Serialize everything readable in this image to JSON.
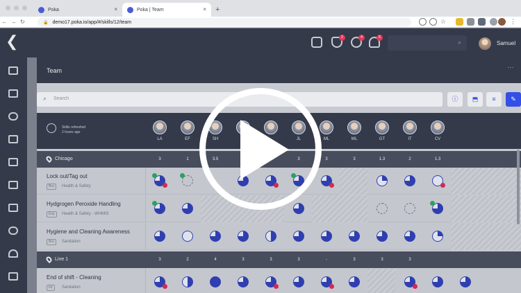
{
  "browser": {
    "tabs": [
      {
        "label": "Poka",
        "active": false
      },
      {
        "label": "Poka | Team",
        "active": true
      }
    ],
    "new_tab": "+",
    "close": "×",
    "url": "demo17.poka.io/app/#/skills/12/team"
  },
  "topbar": {
    "notifications": [
      {
        "icon": "shield-heart-icon",
        "count": "2"
      },
      {
        "icon": "refresh-alert-icon",
        "count": "4"
      },
      {
        "icon": "bell-icon",
        "count": "6"
      }
    ],
    "user_name": "Samuel"
  },
  "page": {
    "title": "Team",
    "more": "···",
    "search_placeholder": "Search",
    "refresh_text": [
      "Skills refreshed",
      "2 hours ago"
    ]
  },
  "members": [
    "LA",
    "EF",
    "SH",
    "",
    "JL",
    "ML",
    "WL",
    "GT",
    "IT",
    "CV"
  ],
  "groups": [
    {
      "name": "Chicago",
      "scores": [
        "3",
        "1",
        "3.5",
        "",
        "3",
        "3",
        "3",
        "1.3",
        "2",
        "1.3"
      ],
      "skills": [
        {
          "name": "Lock out/Tag out",
          "tag": "Bsc",
          "category": "Health & Safety"
        },
        {
          "name": "Hydgrogen Peroxide Handling",
          "tag": "Exp",
          "category": "Health & Safety - WHMIS"
        },
        {
          "name": "Hygiene and Cleaning Awareness",
          "tag": "Bsc",
          "category": "Sanitation"
        }
      ]
    },
    {
      "name": "Line 1",
      "scores": [
        "3",
        "2",
        "4",
        "3",
        "3",
        "3",
        "-",
        "3",
        "3",
        "3"
      ],
      "skills": [
        {
          "name": "End of shift - Cleaning",
          "tag": "Int",
          "category": "Sanitation"
        }
      ]
    }
  ],
  "colors": {
    "chip": "#2f3fb0",
    "flag": "#d42a4e",
    "check": "#2aa35a",
    "primary": "#3250e6"
  }
}
